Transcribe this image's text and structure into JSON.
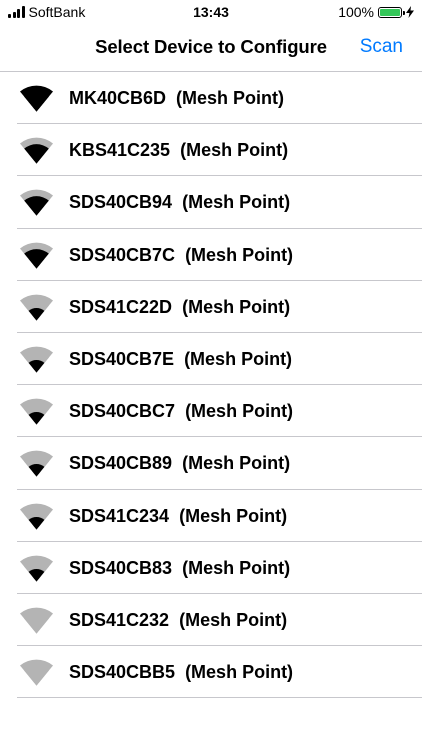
{
  "status_bar": {
    "carrier": "SoftBank",
    "time": "13:43",
    "battery_percent": "100%",
    "battery_level": 1.0,
    "signal_bars": 4,
    "charging": true,
    "battery_color": "#34c759"
  },
  "nav": {
    "title": "Select Device to Configure",
    "scan_label": "Scan",
    "accent_color": "#007aff"
  },
  "colors": {
    "signal_active": "#000000",
    "signal_inactive": "#b4b4b4",
    "separator": "#c7c7cc"
  },
  "devices": [
    {
      "name": "MK40CB6D",
      "type": "(Mesh Point)",
      "signal_level": 4
    },
    {
      "name": "KBS41C235",
      "type": "(Mesh Point)",
      "signal_level": 3
    },
    {
      "name": "SDS40CB94",
      "type": "(Mesh Point)",
      "signal_level": 3
    },
    {
      "name": "SDS40CB7C",
      "type": "(Mesh Point)",
      "signal_level": 3
    },
    {
      "name": "SDS41C22D",
      "type": "(Mesh Point)",
      "signal_level": 2
    },
    {
      "name": "SDS40CB7E",
      "type": "(Mesh Point)",
      "signal_level": 2
    },
    {
      "name": "SDS40CBC7",
      "type": "(Mesh Point)",
      "signal_level": 2
    },
    {
      "name": "SDS40CB89",
      "type": "(Mesh Point)",
      "signal_level": 2
    },
    {
      "name": "SDS41C234",
      "type": "(Mesh Point)",
      "signal_level": 2
    },
    {
      "name": "SDS40CB83",
      "type": "(Mesh Point)",
      "signal_level": 2
    },
    {
      "name": "SDS41C232",
      "type": "(Mesh Point)",
      "signal_level": 0
    },
    {
      "name": "SDS40CBB5",
      "type": "(Mesh Point)",
      "signal_level": 0
    }
  ]
}
